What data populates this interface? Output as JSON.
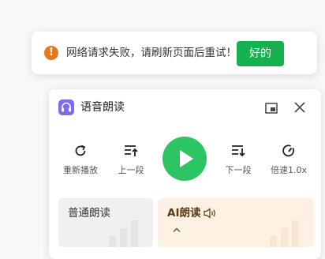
{
  "toast": {
    "icon": "exclamation-icon",
    "message": "网络请求失败，请刷新页面后重试！",
    "ok_label": "好的",
    "colors": {
      "warning": "#e8761c",
      "ok_button": "#16b14f"
    }
  },
  "panel": {
    "title": "语音朗读",
    "app_icon": "headphones-icon",
    "window_buttons": [
      "picture-in-picture-icon",
      "close-icon"
    ],
    "controls": [
      {
        "icon": "refresh-icon",
        "label": "重新播放"
      },
      {
        "icon": "prev-paragraph-icon",
        "label": "上一段"
      },
      {
        "icon": "play-icon",
        "label": ""
      },
      {
        "icon": "next-paragraph-icon",
        "label": "下一段"
      },
      {
        "icon": "speed-icon",
        "label": "倍速1.0x"
      }
    ],
    "modes": [
      {
        "label": "普通朗读",
        "selected": false
      },
      {
        "label": "AI朗读",
        "selected": true,
        "icon": "speaker-icon",
        "expand_icon": "chevron-up-icon"
      }
    ],
    "colors": {
      "play": "#2dc563",
      "app_icon": "#7b6cf0",
      "ai_mode_bg": "#fdf1e4"
    }
  }
}
